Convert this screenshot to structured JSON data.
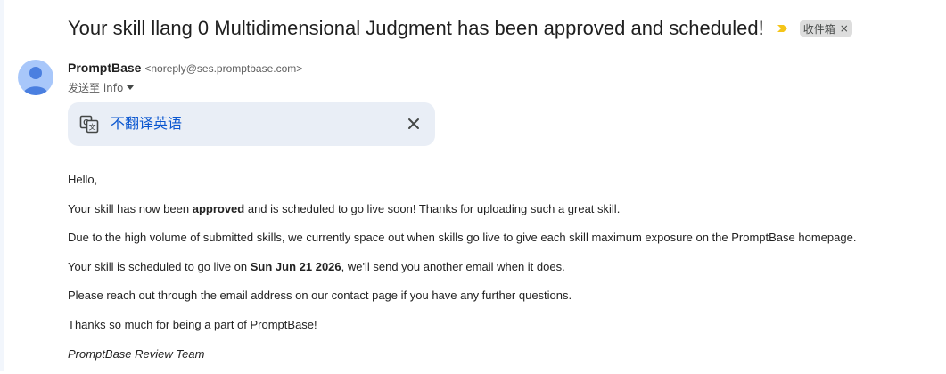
{
  "email": {
    "subject": "Your skill llang 0 Multidimensional Judgment has been approved and scheduled!",
    "label": "收件箱",
    "label_remove": "×",
    "sender_name": "PromptBase",
    "sender_email": "<noreply@ses.promptbase.com>",
    "to_text": "发送至 info"
  },
  "translate": {
    "link_label": "不翻译英语"
  },
  "body": {
    "greeting": "Hello,",
    "p1_before": "Your skill has now been ",
    "p1_bold": "approved",
    "p1_after": " and is scheduled to go live soon! Thanks for uploading such a great skill.",
    "p2": "Due to the high volume of submitted skills, we currently space out when skills go live to give each skill maximum exposure on the PromptBase homepage.",
    "p3_before": "Your skill is scheduled to go live on ",
    "p3_bold": "Sun Jun 21 2026",
    "p3_after": ", we'll send you another email when it does.",
    "p4": "Please reach out through the email address on our contact page if you have any further questions.",
    "p5": "Thanks so much for being a part of PromptBase!",
    "signature": "PromptBase Review Team"
  },
  "icons": {
    "importance": "importance-marker-icon",
    "translate": "translate-icon",
    "close": "close-icon",
    "avatar": "person-avatar-icon",
    "caret": "chevron-down-icon"
  },
  "colors": {
    "importance": "#f5c518",
    "link": "#0b57d0",
    "translate_bg": "#e9eef6",
    "avatar_bg": "#a8c7fa",
    "avatar_fg": "#4a7fe0"
  }
}
